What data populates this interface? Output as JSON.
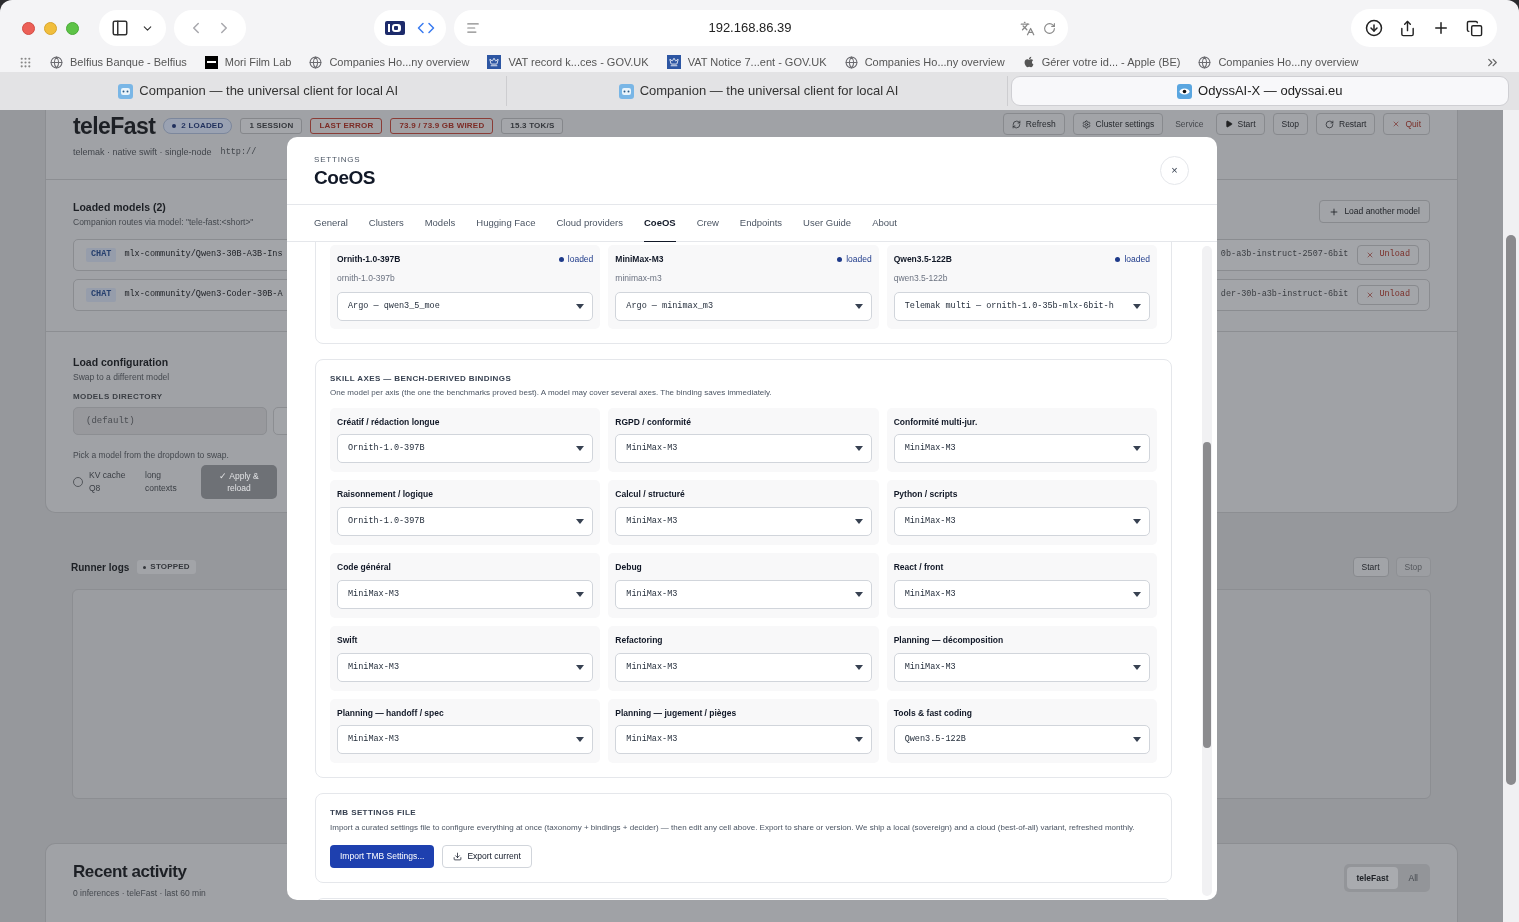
{
  "browser": {
    "address": "192.168.86.39",
    "bookmarks": [
      {
        "label": "Belfius Banque - Belfius",
        "kind": "globe"
      },
      {
        "label": "Mori Film Lab",
        "kind": "logo"
      },
      {
        "label": "Companies Ho...ny overview",
        "kind": "globe"
      },
      {
        "label": "VAT record k...ces - GOV.UK",
        "kind": "crown"
      },
      {
        "label": "VAT Notice 7...ent - GOV.UK",
        "kind": "crown"
      },
      {
        "label": "Companies Ho...ny overview",
        "kind": "globe"
      },
      {
        "label": "Gérer votre id... - Apple (BE)",
        "kind": "apple"
      },
      {
        "label": "Companies Ho...ny overview",
        "kind": "globe"
      }
    ],
    "tabs": [
      {
        "title": "Companion — the universal client for local AI",
        "kind": "companion",
        "selected": false
      },
      {
        "title": "Companion — the universal client for local AI",
        "kind": "companion",
        "selected": false
      },
      {
        "title": "OdyssAI-X — odyssai.eu",
        "kind": "eye",
        "selected": true
      }
    ]
  },
  "page": {
    "header": {
      "title": "teleFast",
      "badges": [
        {
          "label": "2 LOADED",
          "kind": "status"
        },
        {
          "label": "1 SESSION",
          "kind": "plain"
        },
        {
          "label": "LAST ERROR",
          "kind": "error"
        },
        {
          "label": "73.9 / 73.9 GB WIRED",
          "kind": "error"
        },
        {
          "label": "15.3 TOK/S",
          "kind": "plain"
        }
      ],
      "subtitle": "telemak · native swift · single-node",
      "url": "http://",
      "actions": [
        {
          "label": "Refresh",
          "kind": "refresh"
        },
        {
          "label": "Cluster settings",
          "kind": "settings"
        },
        {
          "label": "Service",
          "kind": "label"
        },
        {
          "label": "Start",
          "kind": "start"
        },
        {
          "label": "Stop",
          "kind": "plain"
        },
        {
          "label": "Restart",
          "kind": "restart"
        },
        {
          "label": "Quit",
          "kind": "quit"
        }
      ]
    },
    "loaded_models": {
      "title": "Loaded models (2)",
      "subtitle": "Companion routes via model: \"tele-fast:<short>\"",
      "add_button": "Load another model",
      "rows": [
        {
          "tag": "CHAT",
          "model_start": "mlx-community/Qwen3-30B-A3B-Ins",
          "model_end": "0b-a3b-instruct-2507-6bit",
          "action": "Unload"
        },
        {
          "tag": "CHAT",
          "model_start": "mlx-community/Qwen3-Coder-30B-A",
          "model_end": "der-30b-a3b-instruct-6bit",
          "action": "Unload"
        }
      ]
    },
    "load_config": {
      "title": "Load configuration",
      "subtitle": "Swap to a different model",
      "directory_label": "MODELS DIRECTORY",
      "directory_placeholder": "(default)",
      "hint": "Pick a model from the dropdown to swap.",
      "kv_cache": {
        "label": "KV cache Q8",
        "checked": false
      },
      "note": "long contexts",
      "apply_button": {
        "label": "✓ Apply & reload",
        "disabled": true
      }
    },
    "runner_logs": {
      "title": "Runner logs",
      "status": "STOPPED",
      "buttons": [
        {
          "label": "Start",
          "disabled": false
        },
        {
          "label": "Stop",
          "disabled": true
        }
      ]
    },
    "recent_activity": {
      "title": "Recent activity",
      "subtitle": "0 inferences · teleFast · last 60 min",
      "filters": [
        {
          "label": "teleFast",
          "selected": true
        },
        {
          "label": "All",
          "selected": false
        }
      ]
    }
  },
  "settings_dialog": {
    "eyebrow": "SETTINGS",
    "title": "CoeOS",
    "close": "×",
    "tabs": [
      {
        "label": "General",
        "selected": false
      },
      {
        "label": "Clusters",
        "selected": false
      },
      {
        "label": "Models",
        "selected": false
      },
      {
        "label": "Hugging Face",
        "selected": false
      },
      {
        "label": "Cloud providers",
        "selected": false
      },
      {
        "label": "CoeOS",
        "selected": true
      },
      {
        "label": "Crew",
        "selected": false
      },
      {
        "label": "Endpoints",
        "selected": false
      },
      {
        "label": "User Guide",
        "selected": false
      },
      {
        "label": "About",
        "selected": false
      }
    ],
    "models": [
      {
        "name": "Ornith-1.0-397B",
        "status": "loaded",
        "slug": "ornith-1.0-397b",
        "backend": "Argo — qwen3_5_moe"
      },
      {
        "name": "MiniMax-M3",
        "status": "loaded",
        "slug": "minimax-m3",
        "backend": "Argo — minimax_m3"
      },
      {
        "name": "Qwen3.5-122B",
        "status": "loaded",
        "slug": "qwen3.5-122b",
        "backend": "Telemak multi — ornith-1.0-35b-mlx-6bit-h"
      }
    ],
    "skill_axes": {
      "title": "SKILL AXES — BENCH-DERIVED BINDINGS",
      "description": "One model per axis (the one the benchmarks proved best). A model may cover several axes. The binding saves immediately.",
      "axes": [
        {
          "label": "Créatif / rédaction longue",
          "value": "Ornith-1.0-397B"
        },
        {
          "label": "RGPD / conformité",
          "value": "MiniMax-M3"
        },
        {
          "label": "Conformité multi-jur.",
          "value": "MiniMax-M3"
        },
        {
          "label": "Raisonnement / logique",
          "value": "Ornith-1.0-397B"
        },
        {
          "label": "Calcul / structuré",
          "value": "MiniMax-M3"
        },
        {
          "label": "Python / scripts",
          "value": "MiniMax-M3"
        },
        {
          "label": "Code général",
          "value": "MiniMax-M3"
        },
        {
          "label": "Debug",
          "value": "MiniMax-M3"
        },
        {
          "label": "React / front",
          "value": "MiniMax-M3"
        },
        {
          "label": "Swift",
          "value": "MiniMax-M3"
        },
        {
          "label": "Refactoring",
          "value": "MiniMax-M3"
        },
        {
          "label": "Planning — décomposition",
          "value": "MiniMax-M3"
        },
        {
          "label": "Planning — handoff / spec",
          "value": "MiniMax-M3"
        },
        {
          "label": "Planning — jugement / pièges",
          "value": "MiniMax-M3"
        },
        {
          "label": "Tools & fast coding",
          "value": "Qwen3.5-122B"
        }
      ]
    },
    "tmb_file": {
      "title": "TMB SETTINGS FILE",
      "description": "Import a curated settings file to configure everything at once (taxonomy + bindings + decider) — then edit any cell above. Export to share or version. We ship a local (sovereign) and a cloud (best-of-all) variant, refreshed monthly.",
      "import_button": "Import TMB Settings...",
      "export_button": "Export current"
    }
  }
}
